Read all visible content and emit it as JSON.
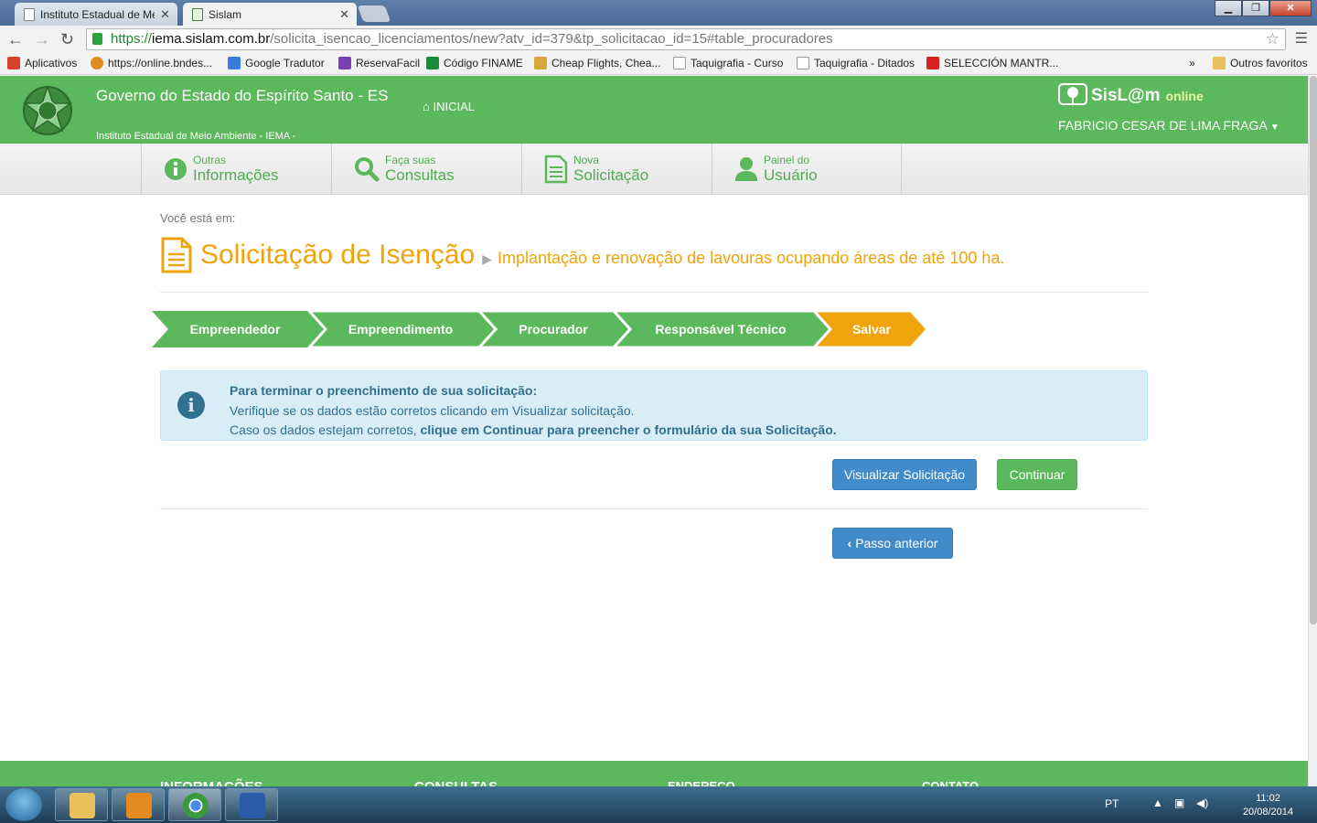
{
  "browser": {
    "tabs": [
      {
        "label": "Instituto Estadual de Meio",
        "active": false
      },
      {
        "label": "Sislam",
        "active": true
      }
    ],
    "url": {
      "scheme": "https://",
      "host": "iema.sislam.com.br",
      "path": "/solicita_isencao_licenciamentos/new?atv_id=379&tp_solicitacao_id=15#table_procuradores"
    },
    "bookmarks": [
      {
        "label": "Aplicativos",
        "icon": "apps-grid-icon",
        "color": "#d9412a"
      },
      {
        "label": "https://online.bndes...",
        "icon": "bndes-icon",
        "color": "#e38a1e"
      },
      {
        "label": "Google Tradutor",
        "icon": "translate-icon",
        "color": "#3a7be0"
      },
      {
        "label": "ReservaFacil",
        "icon": "reservafacil-icon",
        "color": "#7a3fb0"
      },
      {
        "label": "Código FINAME",
        "icon": "finame-icon",
        "color": "#1c8a3a"
      },
      {
        "label": "Cheap Flights, Chea...",
        "icon": "kayak-icon",
        "color": "#d9a63c"
      },
      {
        "label": "Taquigrafia - Curso",
        "icon": "page-icon",
        "color": "#dddddd"
      },
      {
        "label": "Taquigrafia - Ditados",
        "icon": "page-icon",
        "color": "#dddddd"
      },
      {
        "label": "SELECCIÓN MANTR...",
        "icon": "youtube-icon",
        "color": "#d92323"
      }
    ],
    "bookmarks_more": "»",
    "other_bookmarks": "Outros favoritos"
  },
  "header": {
    "gov_title": "Governo do Estado do Espírito Santo - ES",
    "gov_subtitle": "Instituto Estadual de Meio Ambiente - IEMA -",
    "nav_home": "INICIAL",
    "brand": "SisL@m",
    "brand_suffix": "online",
    "user_name": "FABRICIO CESAR DE LIMA FRAGA"
  },
  "subnav": [
    {
      "small": "Outras",
      "big": "Informações",
      "icon": "info-icon"
    },
    {
      "small": "Faça suas",
      "big": "Consultas",
      "icon": "search-icon"
    },
    {
      "small": "Nova",
      "big": "Solicitação",
      "icon": "document-icon"
    },
    {
      "small": "Painel do",
      "big": "Usuário",
      "icon": "user-icon"
    }
  ],
  "main": {
    "breadcrumb": "Você está em:",
    "title": "Solicitação de Isenção",
    "arrow": "▶",
    "subtitle": "Implantação e renovação de lavouras ocupando áreas de até 100 ha."
  },
  "steps": [
    {
      "label": "Empreendedor",
      "state": "done"
    },
    {
      "label": "Empreendimento",
      "state": "done"
    },
    {
      "label": "Procurador",
      "state": "done"
    },
    {
      "label": "Responsável Técnico",
      "state": "done"
    },
    {
      "label": "Salvar",
      "state": "current"
    }
  ],
  "colors": {
    "green": "#5cb85c",
    "orange": "#f0a30a",
    "blue": "#428bca",
    "info_bg": "#d9edf7"
  },
  "alert": {
    "heading": "Para terminar o preenchimento de sua solicitação:",
    "line2": "Verifique se os dados estão corretos clicando em Visualizar solicitação.",
    "line3_prefix": "Caso os dados estejam corretos, ",
    "line3_bold": "clique em Continuar para preencher o formulário da sua Solicitação."
  },
  "buttons": {
    "view": "Visualizar Solicitação",
    "continue": "Continuar",
    "previous": "Passo anterior"
  },
  "footer": {
    "headings": [
      "INFORMAÇÕES",
      "CONSULTAS",
      "ENDEREÇO",
      "CONTATO"
    ]
  },
  "taskbar": {
    "apps": [
      {
        "name": "explorer",
        "color": "#e8c15a"
      },
      {
        "name": "outlook",
        "color": "#e58a1e"
      },
      {
        "name": "chrome",
        "color": "#3b9a3b"
      },
      {
        "name": "word",
        "color": "#2a5caa"
      }
    ],
    "lang": "PT",
    "time": "11:02",
    "date": "20/08/2014"
  }
}
